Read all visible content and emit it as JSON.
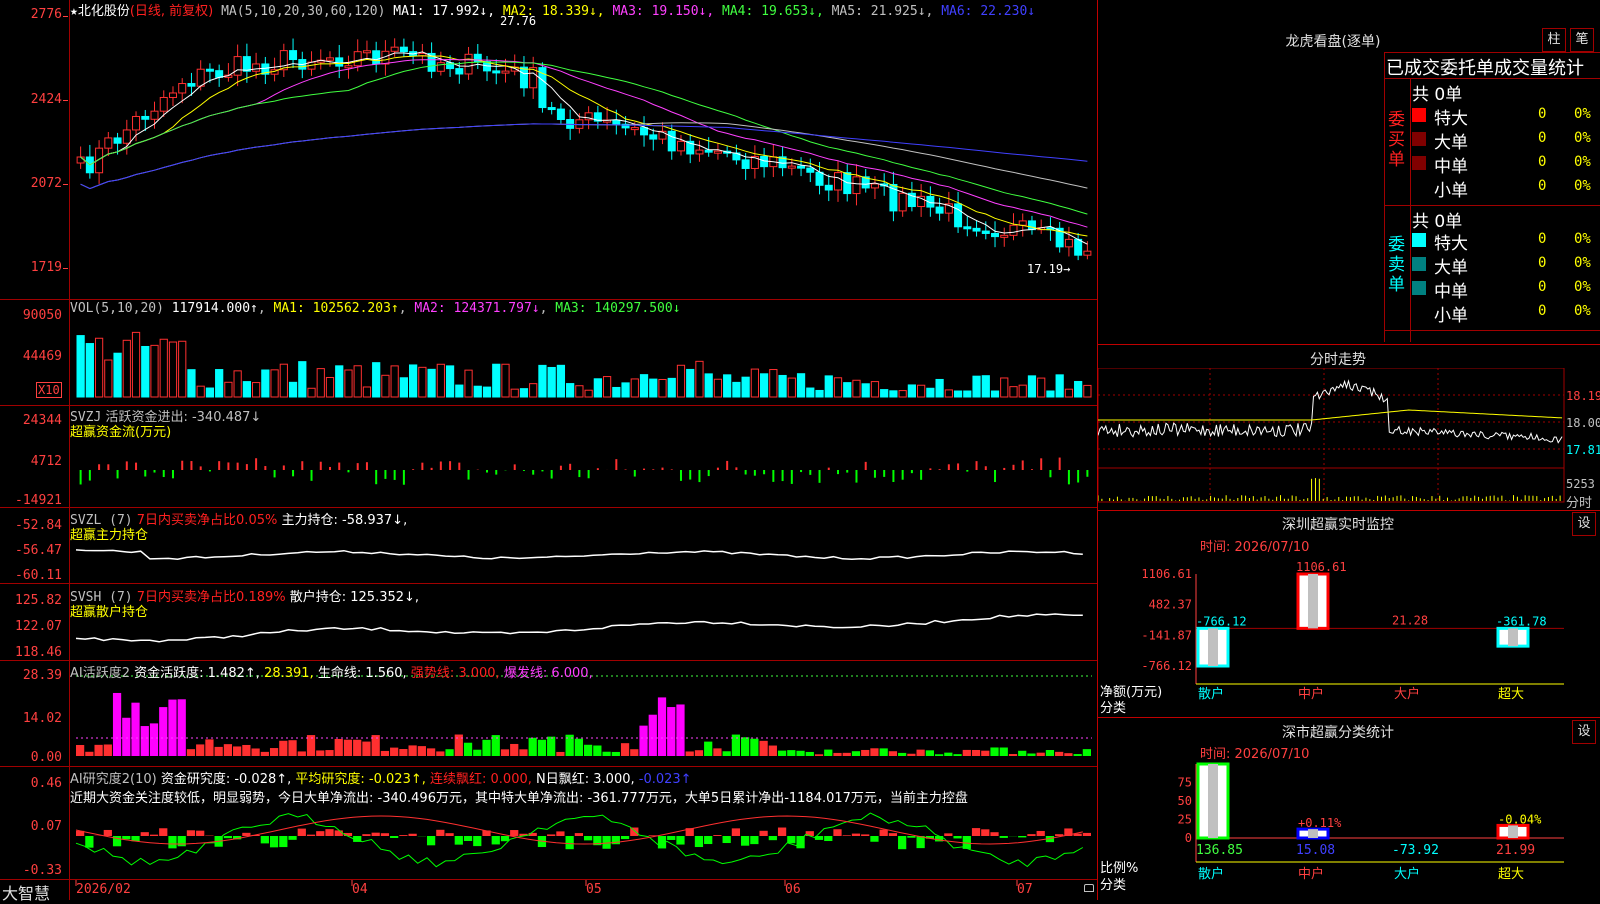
{
  "brand": "大智慧",
  "kline": {
    "title_star": "★",
    "stock_name": "北化股份",
    "period": "(日线, 前复权)",
    "ma_params": "MA(5,10,20,30,60,120)",
    "ma_values": [
      {
        "label": "MA1: 17.992↓",
        "color": "#ffffff"
      },
      {
        "label": "MA2: 18.339↓",
        "color": "#ffff00"
      },
      {
        "label": "MA3: 19.150↓",
        "color": "#ff40ff"
      },
      {
        "label": "MA4: 19.653↓",
        "color": "#40ff40"
      },
      {
        "label": "MA5: 21.925↓",
        "color": "#c0c0c0"
      },
      {
        "label": "MA6: 22.230↓",
        "color": "#4040ff"
      }
    ],
    "high_label": "27.76",
    "low_label": "17.19→",
    "axis": [
      "2776",
      "2424",
      "2072",
      "1719"
    ]
  },
  "vol": {
    "header": "VOL(5,10,20)",
    "value": "117914.000↑",
    "ma1": "MA1: 102562.203↑",
    "ma2": "MA2: 124371.797↓",
    "ma3": "MA3: 140297.500↓",
    "axis": [
      "90050",
      "44469"
    ],
    "unit": "X10"
  },
  "svzj": {
    "header": "SVZJ",
    "line1": "活跃资金进出: -340.487↓",
    "line2": "超赢资金流(万元)",
    "axis": [
      "24344",
      "4712",
      "-14921"
    ]
  },
  "svzl": {
    "header": "SVZL (7)",
    "red_text": "7日内买卖净占比0.05%",
    "white_text": "主力持仓: -58.937↓,",
    "line2": "超赢主力持仓",
    "axis": [
      "-52.84",
      "-56.47",
      "-60.11"
    ]
  },
  "svsh": {
    "header": "SVSH (7)",
    "red_text": "7日内买卖净占比0.189%",
    "white_text": "散户持仓: 125.352↓,",
    "line2": "超赢散户持仓",
    "axis": [
      "125.82",
      "122.07",
      "118.46"
    ]
  },
  "ai1": {
    "header": "AI活跃度2",
    "v1": "资金活跃度: 1.482↑,",
    "v2": "28.391,",
    "v3": "生命线: 1.560,",
    "v4": "强势线: 3.000,",
    "v5": "爆发线: 6.000,",
    "axis": [
      "28.39",
      "14.02",
      "0.00"
    ]
  },
  "ai2": {
    "header": "AI研究度2(10)",
    "v1": "资金研究度: -0.028↑,",
    "v2": "平均研究度: -0.023↑,",
    "v3": "连续飘红: 0.000,",
    "v4": "N日飘红: 3.000,",
    "v5": "-0.023↑",
    "comment": "近期大资金关注度较低，明显弱势，今日大单净流出: -340.496万元，其中特大单净流出: -361.777万元，大单5日累计净出-1184.017万元，当前主力控盘",
    "axis": [
      "0.46",
      "0.07",
      "-0.33"
    ]
  },
  "date_axis": [
    "2026/02",
    "04",
    "05",
    "06",
    "07"
  ],
  "lhb": {
    "title": "龙虎看盘(逐单)",
    "btn1": "柱",
    "btn2": "笔",
    "subtitle": "已成交委托单成交量统计",
    "buy": {
      "label": "委买单",
      "total": "共 0单",
      "rows": [
        {
          "name": "特大",
          "count": "0",
          "pct": "0%",
          "color": "#ff0000"
        },
        {
          "name": "大单",
          "count": "0",
          "pct": "0%",
          "color": "#800000"
        },
        {
          "name": "中单",
          "count": "0",
          "pct": "0%",
          "color": "#800000"
        },
        {
          "name": "小单",
          "count": "0",
          "pct": "0%",
          "color": "#000000"
        }
      ]
    },
    "sell": {
      "label": "委卖单",
      "total": "共 0单",
      "rows": [
        {
          "name": "特大",
          "count": "0",
          "pct": "0%",
          "color": "#00ffff"
        },
        {
          "name": "大单",
          "count": "0",
          "pct": "0%",
          "color": "#008080"
        },
        {
          "name": "中单",
          "count": "0",
          "pct": "0%",
          "color": "#008080"
        },
        {
          "name": "小单",
          "count": "0",
          "pct": "0%",
          "color": "#000000"
        }
      ]
    }
  },
  "intraday": {
    "title": "分时走势",
    "axis": [
      "18.19",
      "18.00",
      "17.81"
    ],
    "vol_axis": "5253",
    "vol_label": "分时"
  },
  "sz_monitor": {
    "title": "深圳超赢实时监控",
    "btn": "设",
    "time": "时间: 2026/07/10",
    "axis": [
      "1106.61",
      "482.37",
      "-141.87",
      "-766.12"
    ],
    "ylabel1": "净额(万元)",
    "ylabel2": "分类",
    "categories": [
      "散户",
      "中户",
      "大户",
      "超大"
    ],
    "values": [
      -766.12,
      1106.61,
      21.28,
      -361.78
    ],
    "value_labels": [
      "-766.12",
      "1106.61",
      "21.28",
      "-361.78"
    ]
  },
  "sz_stats": {
    "title": "深市超赢分类统计",
    "btn": "设",
    "time": "时间: 2026/07/10",
    "axis": [
      "75",
      "50",
      "25",
      "0"
    ],
    "ylabel1": "比例%",
    "ylabel2": "分类",
    "categories": [
      "散户",
      "中户",
      "大户",
      "超大"
    ],
    "bar_pct": [
      100,
      12,
      0,
      17
    ],
    "pct_labels": [
      "",
      "+0.11%",
      "",
      "-0.04%"
    ],
    "values": [
      "136.85",
      "15.08",
      "-73.92",
      "21.99"
    ]
  }
}
